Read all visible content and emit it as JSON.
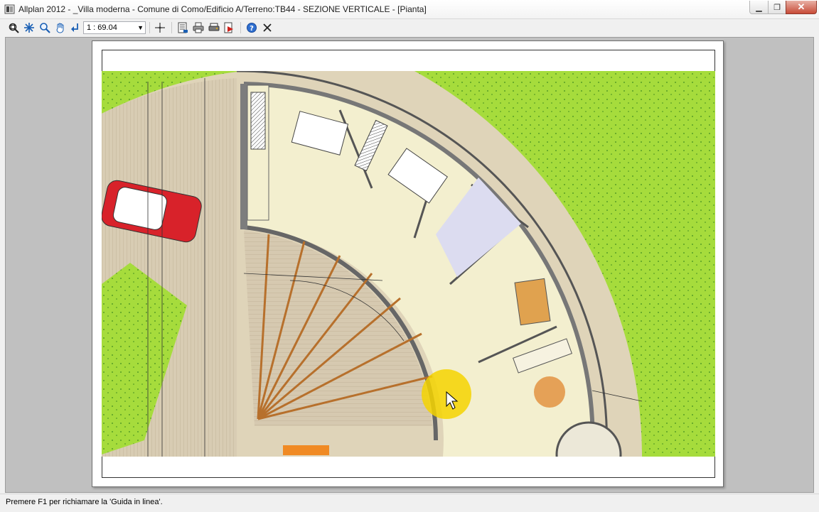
{
  "window": {
    "title": "Allplan 2012 - _Villa moderna - Comune di Como/Edificio A/Terreno:TB44 - SEZIONE VERTICALE - [Pianta]",
    "minimize_icon": "minimize-icon",
    "maximize_icon": "maximize-icon",
    "close_icon": "close-icon"
  },
  "toolbar": {
    "scale_value": "1 : 69.04",
    "icons": [
      "zoom-window-icon",
      "regen-icon",
      "zoom-icon",
      "pan-hand-icon",
      "undo-view-icon",
      "dropdown-icon",
      "crosshair-icon",
      "sheet-settings-icon",
      "print-icon",
      "plotter-icon",
      "pdf-export-icon",
      "help-icon",
      "close-preview-icon"
    ]
  },
  "statusbar": {
    "text": "Premere F1 per richiamare la 'Guida in linea'."
  },
  "colors": {
    "lawn": "#a6dc3c",
    "deck": "#d6c9b0",
    "interior_floor": "#f3efcf",
    "wall": "#7d7d7d",
    "cursor_highlight": "#f4d400"
  }
}
